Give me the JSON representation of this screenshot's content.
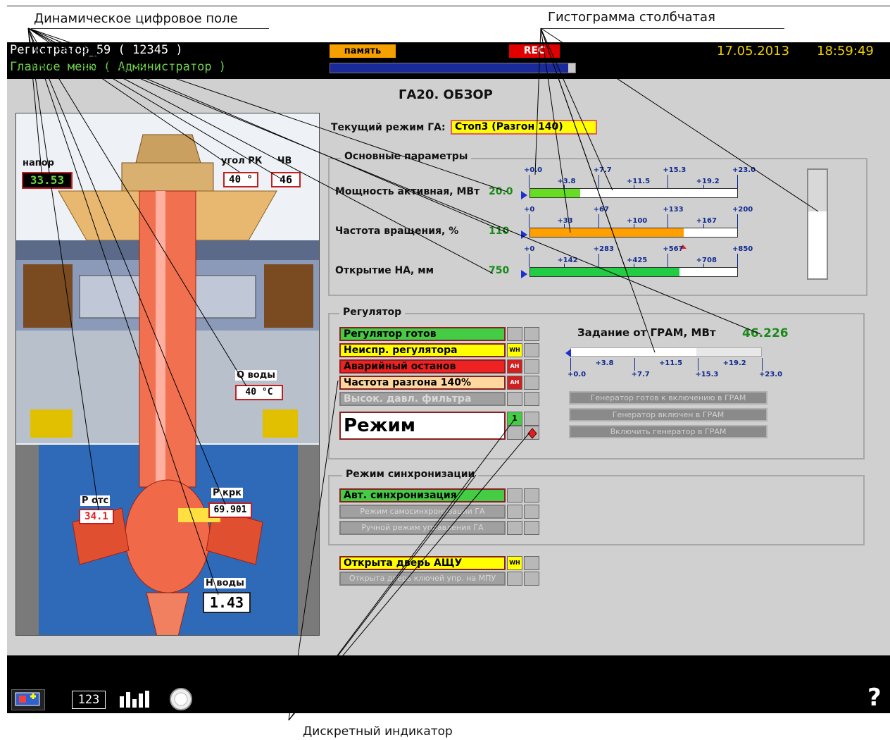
{
  "callouts": {
    "digital_field": "Динамическое цифровое поле",
    "histogram": "Гистограмма столбчатая",
    "discrete_indicator": "Дискретный индикатор"
  },
  "header": {
    "registrar": "Регистратор_59 ( 12345 )",
    "menu": "Главное меню ( Администратор )",
    "memory_label": "память",
    "rec_label": "REC",
    "date": "17.05.2013",
    "time": "18:59:49",
    "memory_progress_fraction": 0.97
  },
  "screen": {
    "title": "ГА20. ОБЗОР",
    "current_mode_label": "Текущий режим ГА:",
    "current_mode_value": "Стоп3 (Разгон 140)"
  },
  "picture": {
    "napor_label": "напор",
    "napor_value": "33.53",
    "angle_label": "угол РК",
    "angle_value": "40 °",
    "chv_label": "ЧВ",
    "chv_value": "46",
    "qwater_label": "Q воды",
    "qwater_value": "40 °C",
    "pots_label": "P отс",
    "pots_value": "34.1",
    "pkrk_label": "P крк",
    "pkrk_value": "69.901",
    "hwater_label": "H воды",
    "hwater_value": "1.43"
  },
  "main_params": {
    "title": "Основные параметры",
    "rows": [
      {
        "label": "Мощность активная, МВт",
        "value": "20.0",
        "fill_fraction": 0.24,
        "color": "#66dd22",
        "ticks_top": [
          "+0.0",
          "+7.7",
          "+15.3",
          "+23.0"
        ],
        "ticks_bottom": [
          "+3.8",
          "+11.5",
          "+19.2"
        ]
      },
      {
        "label": "Частота вращения, %",
        "value": "110",
        "fill_fraction": 0.74,
        "color": "#ffa000",
        "ticks_top": [
          "+0",
          "+67",
          "+133",
          "+200"
        ],
        "ticks_bottom": [
          "+33",
          "+100",
          "+167"
        ]
      },
      {
        "label": "Открытие НА, мм",
        "value": "750",
        "fill_fraction": 0.72,
        "color": "#22cc44",
        "ticks_top": [
          "+0",
          "+283",
          "+567",
          "+850"
        ],
        "ticks_bottom": [
          "+142",
          "+425",
          "+708"
        ]
      }
    ],
    "vertical_level_fraction": 0.62
  },
  "regulator": {
    "title": "Регулятор",
    "indicators": [
      {
        "label": "Регулятор готов",
        "tag": ""
      },
      {
        "label": "Неиспр. регулятора",
        "tag": "WH"
      },
      {
        "label": "Аварийный останов",
        "tag": "AH"
      },
      {
        "label": "Частота разгона 140%",
        "tag": "AH"
      },
      {
        "label": "Высок. давл. фильтра",
        "tag": ""
      }
    ],
    "mode_label": "Режим",
    "mode_flag": "1",
    "task_label": "Задание от ГРАМ, МВт",
    "task_value": "46.226",
    "task_fill_fraction": 0.66,
    "task_ticks_top": [
      "+3.8",
      "+11.5",
      "+19.2"
    ],
    "task_ticks_bottom": [
      "+0.0",
      "+7.7",
      "+15.3",
      "+23.0"
    ],
    "gram_buttons": [
      "Генератор готов к включению в ГРАМ",
      "Генератор включен в ГРАМ",
      "Включить генератор в ГРАМ"
    ]
  },
  "sync": {
    "title": "Режим синхронизации",
    "indicators": [
      "Авт. синхронизация",
      "Режим самосинхронизации ГА",
      "Ручной режим управления ГА"
    ]
  },
  "doors": {
    "indicators": [
      {
        "label": "Открыта дверь АЩУ",
        "tag": "WH"
      },
      {
        "label": "Открыта дверь ключей упр. на МПУ",
        "tag": ""
      }
    ]
  },
  "footer": {
    "digits_label": "123",
    "help_label": "?"
  },
  "colors": {
    "ok_green": "#44cc44",
    "warn_yellow": "#ffff00",
    "alarm_red": "#ee2222",
    "alarm_light": "#ffd8a0",
    "date_yellow": "#f0d000"
  }
}
